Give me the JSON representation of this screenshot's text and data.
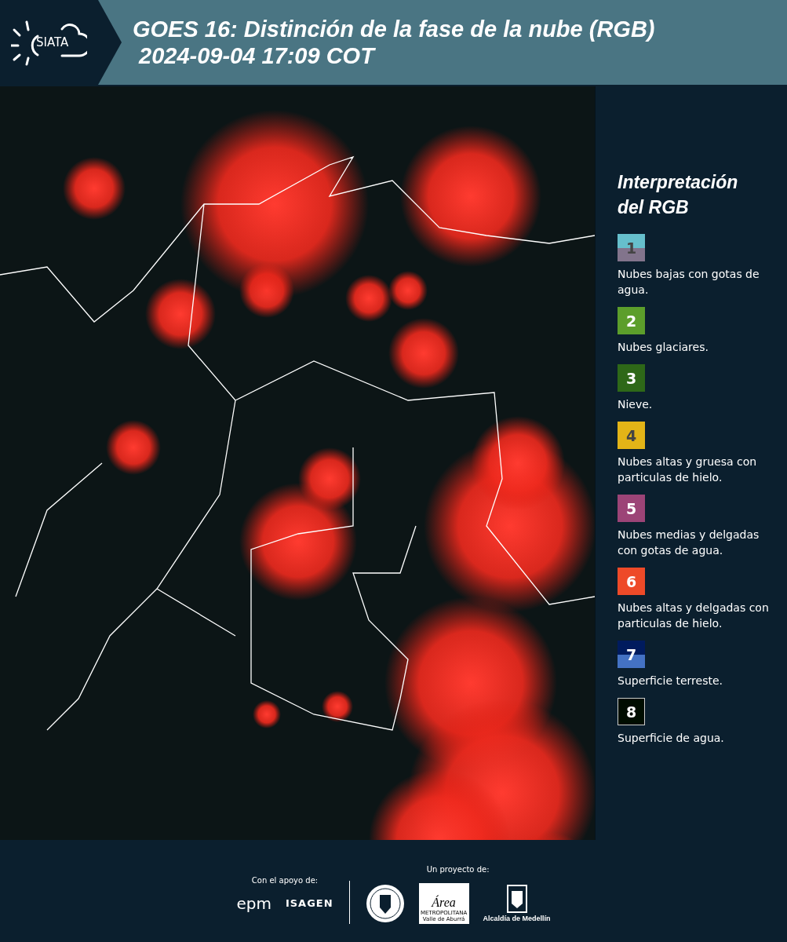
{
  "header": {
    "logo": "SIATA",
    "title": "GOES 16: Distinción de la fase de la nube (RGB)",
    "timestamp": "2024-09-04 17:09 COT"
  },
  "legend": {
    "title": "Interpretación del RGB",
    "items": [
      {
        "number": "1",
        "bands": [
          {
            "color": "#66bfcc"
          },
          {
            "color": "#82748c"
          }
        ],
        "label": "Nubes bajas con gotas de agua."
      },
      {
        "number": "2",
        "bands": [
          {
            "color": "#5c9e2b"
          }
        ],
        "label": "Nubes glaciares."
      },
      {
        "number": "3",
        "bands": [
          {
            "color": "#2e6818"
          }
        ],
        "label": "Nieve."
      },
      {
        "number": "4",
        "bands": [
          {
            "color": "#e3b417"
          }
        ],
        "label": "Nubes altas y gruesa con particulas de hielo."
      },
      {
        "number": "5",
        "bands": [
          {
            "color": "#9c4477"
          }
        ],
        "label": "Nubes medias y delgadas con gotas de agua."
      },
      {
        "number": "6",
        "bands": [
          {
            "color": "#ee4a28"
          }
        ],
        "label": "Nubes altas y delgadas con particulas de hielo."
      },
      {
        "number": "7",
        "bands": [
          {
            "color": "#001b5e"
          },
          {
            "color": "#4472c4"
          }
        ],
        "label": "Superficie terreste."
      },
      {
        "number": "8",
        "bands": [
          {
            "color": "#000d00"
          }
        ],
        "label": "Superficie de agua."
      }
    ]
  },
  "footer": {
    "support_label": "Con el apoyo de:",
    "supporters": [
      "epm",
      "ISAGEN"
    ],
    "project_label": "Un proyecto de:",
    "partners": [
      {
        "kind": "seal"
      },
      {
        "kind": "area",
        "name": "Área",
        "line1": "METROPOLITANA",
        "line2": "Valle de Aburrá"
      },
      {
        "kind": "alcaldia",
        "caption": "Alcaldía de Medellín"
      }
    ]
  }
}
